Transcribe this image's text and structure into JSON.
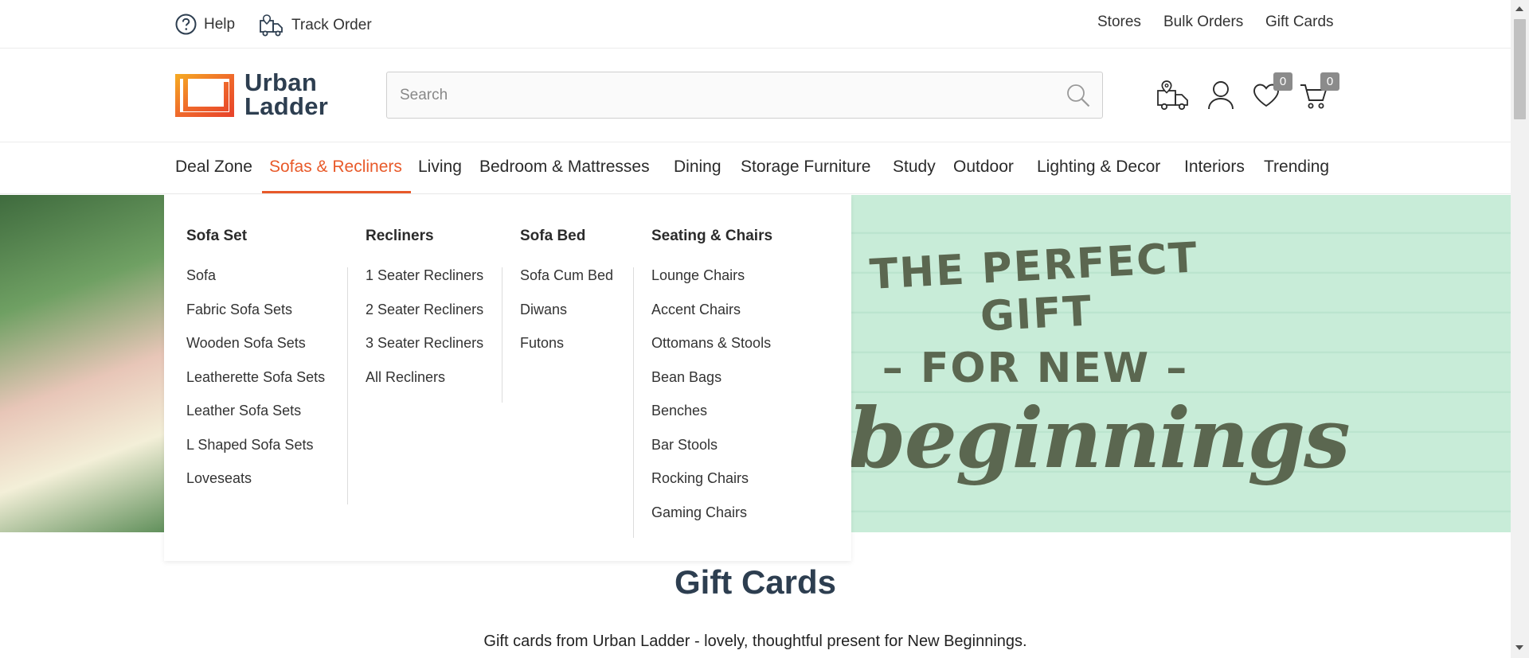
{
  "topbar": {
    "help_label": "Help",
    "track_order_label": "Track Order",
    "stores_label": "Stores",
    "bulk_orders_label": "Bulk Orders",
    "gift_cards_label": "Gift Cards"
  },
  "header": {
    "logo_line1": "Urban",
    "logo_line2": "Ladder",
    "brand_color": "#e85a2a",
    "search_placeholder": "Search",
    "wishlist_count": "0",
    "cart_count": "0"
  },
  "nav": {
    "items": [
      "Deal Zone",
      "Sofas & Recliners",
      "Living",
      "Bedroom & Mattresses",
      "Dining",
      "Storage Furniture",
      "Study",
      "Outdoor",
      "Lighting & Decor",
      "Interiors",
      "Trending"
    ],
    "active": "Sofas & Recliners"
  },
  "menu": {
    "columns": [
      {
        "heading": "Sofa Set",
        "items": [
          "Sofa",
          "Fabric Sofa Sets",
          "Wooden Sofa Sets",
          "Leatherette Sofa Sets",
          "Leather Sofa Sets",
          "L Shaped Sofa Sets",
          "Loveseats"
        ]
      },
      {
        "heading": "Recliners",
        "items": [
          "1 Seater Recliners",
          "2 Seater Recliners",
          "3 Seater Recliners",
          "All Recliners"
        ]
      },
      {
        "heading": "Sofa Bed",
        "items": [
          "Sofa Cum Bed",
          "Diwans",
          "Futons"
        ]
      },
      {
        "heading": "Seating & Chairs",
        "items": [
          "Lounge Chairs",
          "Accent Chairs",
          "Ottomans & Stools",
          "Bean Bags",
          "Benches",
          "Bar Stools",
          "Rocking Chairs",
          "Gaming Chairs"
        ]
      }
    ]
  },
  "hero": {
    "line1": "THE PERFECT GIFT",
    "line2": "– FOR NEW –",
    "line3": "beginnings"
  },
  "giftcards": {
    "title": "Gift Cards",
    "subtitle": "Gift cards from Urban Ladder - lovely, thoughtful present for New Beginnings."
  }
}
